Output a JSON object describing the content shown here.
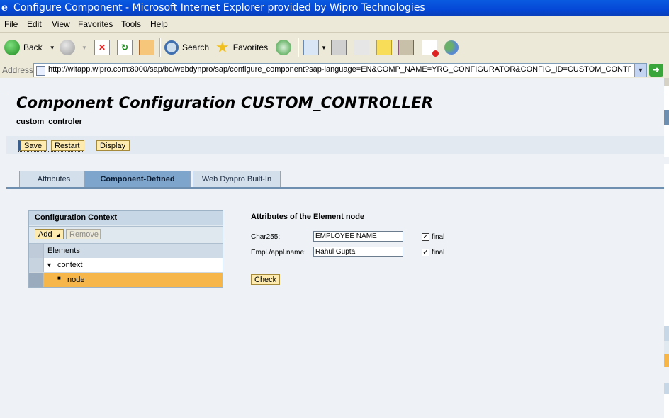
{
  "browser": {
    "window_title": "Configure Component - Microsoft Internet Explorer provided by Wipro Technologies",
    "menu": [
      "File",
      "Edit",
      "View",
      "Favorites",
      "Tools",
      "Help"
    ],
    "toolbar": {
      "back": "Back",
      "search": "Search",
      "favorites": "Favorites"
    },
    "address_label": "Address",
    "url": "http://wltapp.wipro.com:8000/sap/bc/webdynpro/sap/configure_component?sap-language=EN&COMP_NAME=YRG_CONFIGURATOR&CONFIG_ID=CUSTOM_CONTROLLER"
  },
  "page": {
    "title": "Component Configuration CUSTOM_CONTROLLER",
    "subtitle": "custom_controler",
    "buttons": {
      "save": "Save",
      "restart": "Restart",
      "display": "Display"
    },
    "tabs": [
      {
        "label": "Attributes",
        "active": false
      },
      {
        "label": "Component-Defined",
        "active": true
      },
      {
        "label": "Web Dynpro Built-In",
        "active": false
      }
    ]
  },
  "context_panel": {
    "title": "Configuration Context",
    "add_label": "Add",
    "remove_label": "Remove",
    "column_header": "Elements",
    "tree": [
      {
        "label": "context",
        "expanded": true,
        "selected": false
      },
      {
        "label": "node",
        "selected": true
      }
    ]
  },
  "attributes": {
    "heading": "Attributes of the Element node",
    "fields": [
      {
        "label": "Char255:",
        "value": "EMPLOYEE NAME",
        "final_label": "final",
        "final_checked": true
      },
      {
        "label": "Empl./appl.name:",
        "value": "Rahul Gupta",
        "final_label": "final",
        "final_checked": true
      }
    ],
    "check_label": "Check"
  },
  "colors": {
    "titlebar": "#0447d6",
    "sap_button": "#fdebb0",
    "selected_row": "#f7b64a",
    "active_tab": "#7ea6cc"
  }
}
